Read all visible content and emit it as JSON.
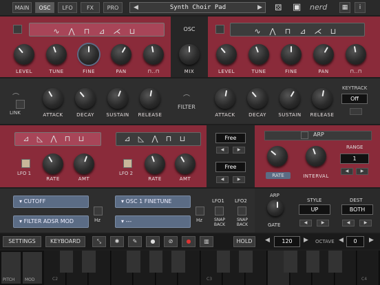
{
  "tabs": [
    "MAIN",
    "OSC",
    "LFO",
    "FX",
    "PRO"
  ],
  "preset": "Synth Choir Pad",
  "brand": "nerd",
  "osc": {
    "label": "OSC",
    "knob_labels": [
      "LEVEL",
      "TUNE",
      "FINE",
      "PAN"
    ],
    "extra_label": "⊓..⊓",
    "mix_label": "MIX"
  },
  "env": {
    "link_label": "LINK",
    "labels": [
      "ATTACK",
      "DECAY",
      "SUSTAIN",
      "RELEASE"
    ],
    "filter_label": "FILTER",
    "keytrack_label": "KEYTRACK",
    "keytrack_value": "Off"
  },
  "lfo": {
    "lfo1": "LFO 1",
    "lfo2": "LFO 2",
    "rate": "RATE",
    "amt": "AMT",
    "free1": "Free",
    "free2": "Free"
  },
  "arp": {
    "title": "ARP",
    "range_label": "RANGE",
    "range_value": "1",
    "rate": "RATE",
    "interval": "INTERVAL",
    "arp_label": "ARP",
    "gate": "GATE",
    "style_label": "STYLE",
    "style_value": "UP",
    "dest_label": "DEST",
    "dest_value": "BOTH"
  },
  "mod": {
    "dest1": "CUTOFF",
    "dest2": "FILTER ADSR MOD",
    "dest3": "OSC 1 FINETUNE",
    "dest4": "---",
    "hz": "Hz",
    "lfo01": "LFO1",
    "lfo02": "LFO2",
    "snap": "SNAP BACK"
  },
  "toolbar": {
    "settings": "SETTINGS",
    "keyboard": "KEYBOARD",
    "hold": "HOLD",
    "tempo": "120",
    "octave_label": "OCTAVE",
    "octave": "0"
  },
  "keys": {
    "pitch": "PITCH",
    "mod": "MOD",
    "c2": "C2",
    "c3": "C3",
    "c4": "C4"
  },
  "colors": {
    "panel_red": "#8a2b3a",
    "panel_dark": "#2e2e2e",
    "accent_blue": "#5b6c85"
  }
}
